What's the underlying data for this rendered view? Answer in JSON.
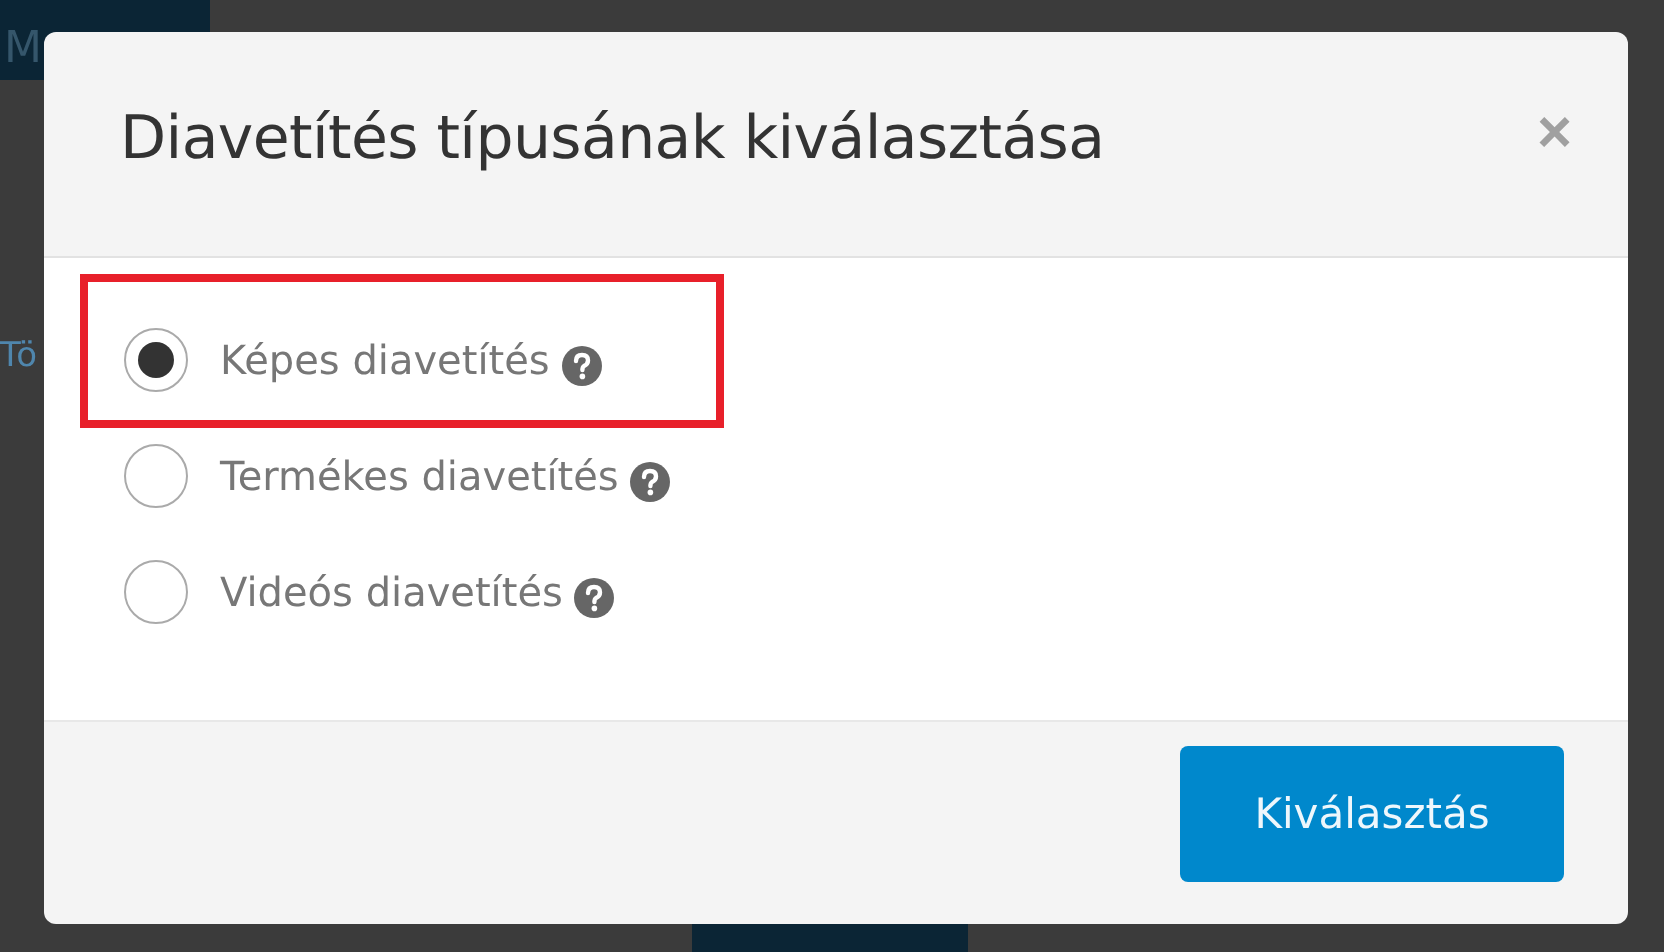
{
  "background": {
    "button_label": "M",
    "side_text": "Tö"
  },
  "dialog": {
    "title": "Diavetítés típusának kiválasztása",
    "close_label": "×",
    "options": [
      {
        "label": "Képes diavetítés",
        "selected": true,
        "highlighted": true
      },
      {
        "label": "Termékes diavetítés",
        "selected": false,
        "highlighted": false
      },
      {
        "label": "Videós diavetítés",
        "selected": false,
        "highlighted": false
      }
    ],
    "submit_label": "Kiválasztás"
  }
}
